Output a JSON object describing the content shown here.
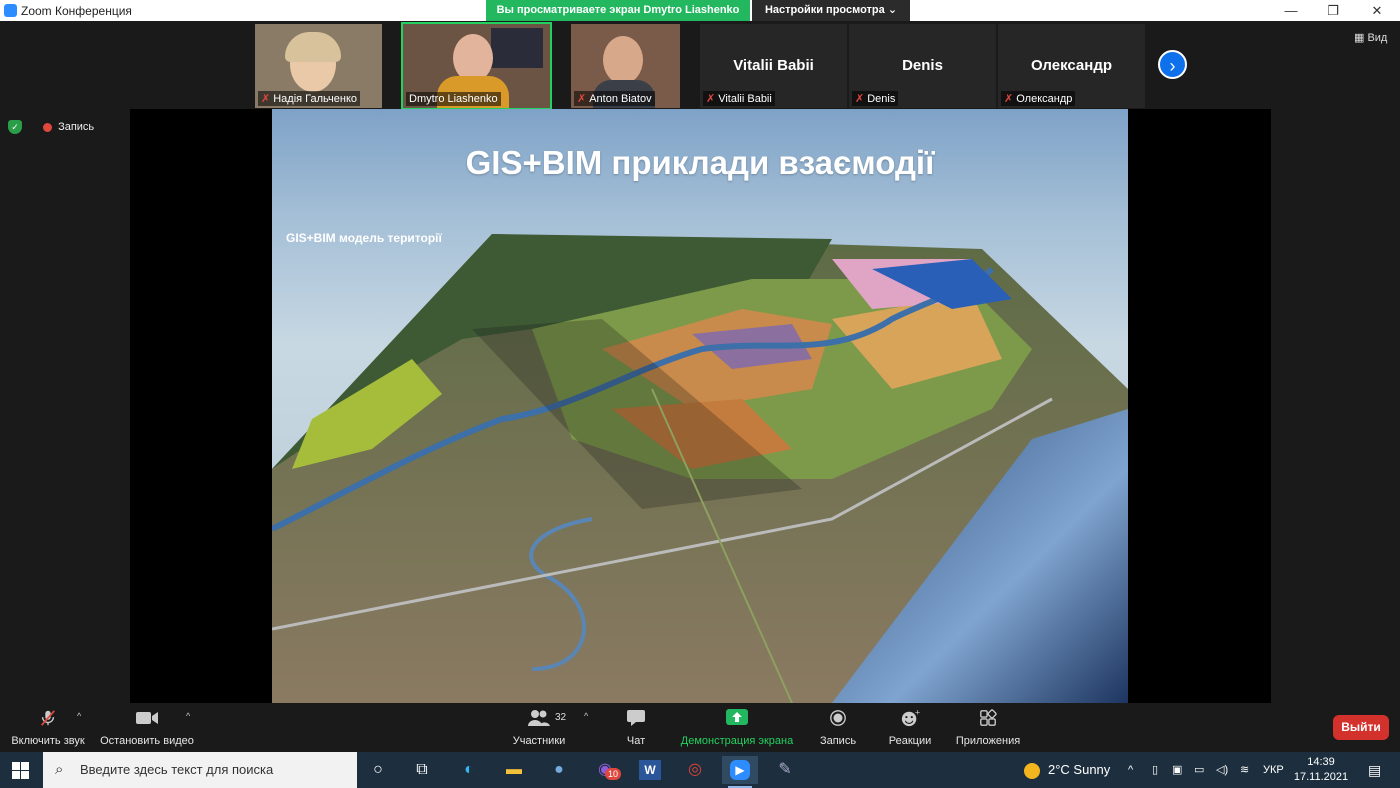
{
  "window": {
    "title": "Zoom Конференция",
    "share_banner": "Вы просматриваете экран Dmytro Liashenko",
    "view_options": "Настройки просмотра ⌄",
    "minimize": "—",
    "restore": "❐",
    "close": "✕"
  },
  "gallery": {
    "view_label": "Вид",
    "participants": [
      {
        "name": "Надія Гальченко",
        "muted": true,
        "video": true
      },
      {
        "name": "Dmytro Liashenko",
        "muted": false,
        "video": true
      },
      {
        "name": "Anton Biatov",
        "muted": true,
        "video": true
      },
      {
        "name": "Vitalii Babii",
        "muted": true,
        "video": false
      },
      {
        "name": "Denis",
        "muted": true,
        "video": false
      },
      {
        "name": "Олександр",
        "muted": true,
        "video": false
      }
    ]
  },
  "status": {
    "recording_label": "Запись"
  },
  "slide": {
    "title": "GIS+BIM приклади взаємодії",
    "subtitle": "GIS+BIM модель території"
  },
  "toolbar": {
    "unmute": "Включить звук",
    "stop_video": "Остановить видео",
    "participants": "Участники",
    "participants_count": "32",
    "chat": "Чат",
    "share_screen": "Демонстрация экрана",
    "record": "Запись",
    "reactions": "Реакции",
    "apps": "Приложения",
    "leave": "Выйти"
  },
  "taskbar": {
    "search_placeholder": "Введите здесь текст для поиска",
    "weather": "2°C  Sunny",
    "language": "УКР",
    "time": "14:39",
    "date": "17.11.2021",
    "viber_badge": "10"
  },
  "colors": {
    "zoom_blue": "#2d8cff",
    "share_green": "#23b860",
    "leave_red": "#d3312b",
    "taskbar": "#1d2f3e"
  }
}
